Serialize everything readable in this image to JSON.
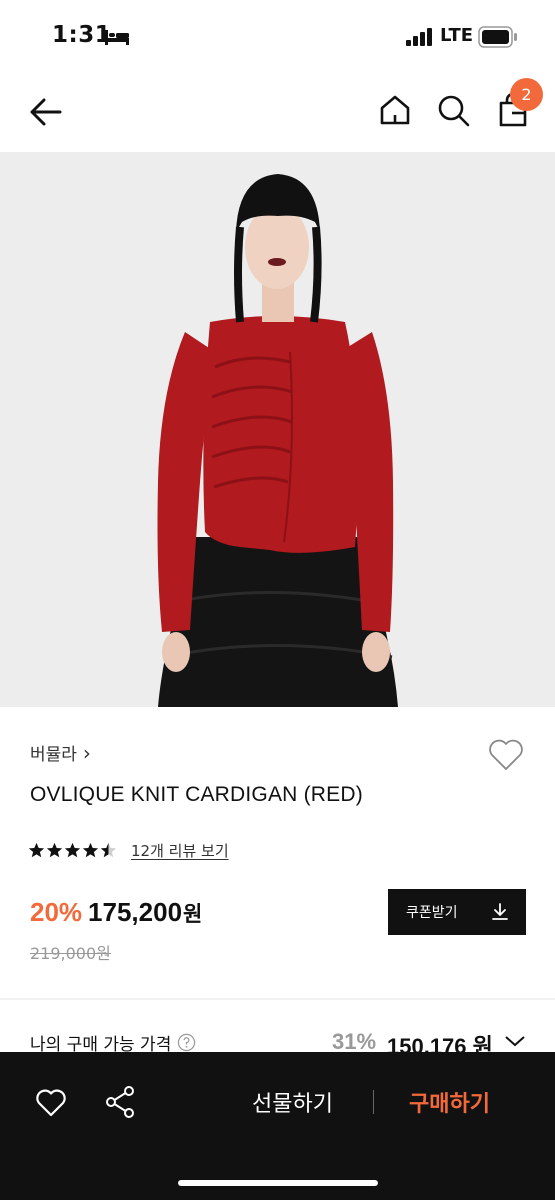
{
  "status_bar": {
    "time": "1:31",
    "network": "LTE"
  },
  "nav": {
    "cart_count": "2"
  },
  "product": {
    "brand": "버뮬라",
    "brand_chevron": "›",
    "title": "OVLIQUE KNIT CARDIGAN (RED)",
    "rating": 4.5,
    "review_link": "12개 리뷰 보기",
    "discount": "20%",
    "sale_price": "175,200",
    "currency": "원",
    "original_price": "219,000원",
    "coupon_label": "쿠폰받기"
  },
  "my_price": {
    "label": "나의 구매 가능 가격",
    "discount": "31%",
    "price": "150,176 원"
  },
  "bottom_bar": {
    "gift_label": "선물하기",
    "buy_label": "구매하기"
  },
  "colors": {
    "accent": "#f26a3b",
    "dark": "#111111",
    "cardigan": "#b11a1e"
  },
  "icons": [
    "bed-icon",
    "signal-icon",
    "battery-icon",
    "back-icon",
    "home-icon",
    "search-icon",
    "bag-icon",
    "heart-icon",
    "star-icon",
    "help-icon",
    "chevron-down-icon",
    "share-icon",
    "download-icon"
  ]
}
